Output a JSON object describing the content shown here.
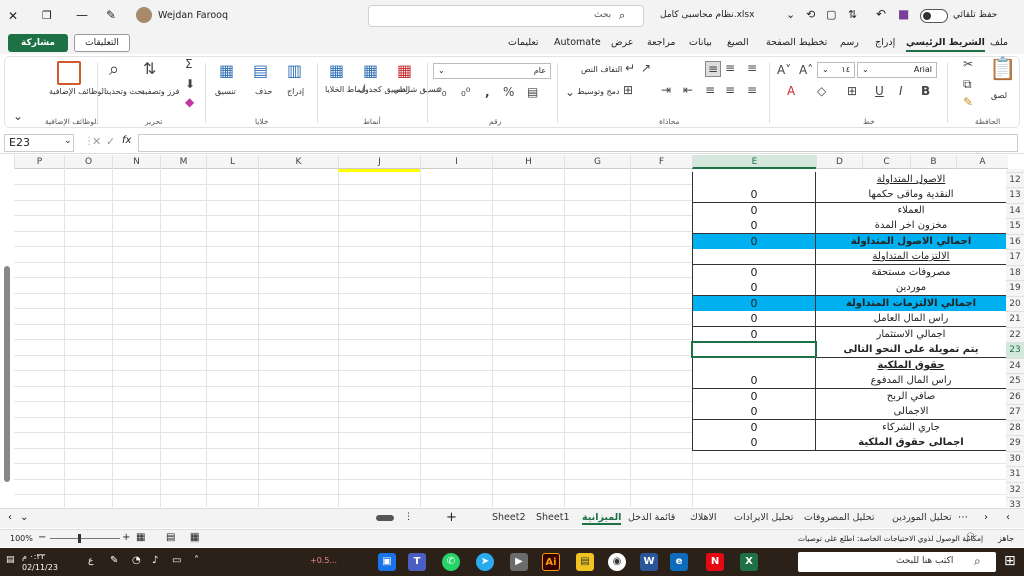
{
  "titlebar": {
    "autosave_label": "حفظ تلقائي",
    "file_name": "نظام محاسبى كامل.xlsx",
    "search_placeholder": "بحث",
    "user_name": "Wejdan Farooq"
  },
  "menu": {
    "items": [
      "ملف",
      "الشريط الرئيسي",
      "إدراج",
      "رسم",
      "تخطيط الصفحة",
      "الصيغ",
      "بيانات",
      "مراجعة",
      "عرض",
      "Automate",
      "تعليمات"
    ],
    "active": "الشريط الرئيسي",
    "share_label": "مشاركة",
    "comments_label": "التعليقات"
  },
  "ribbon": {
    "groups": {
      "clipboard": "الحافظة",
      "font": "خط",
      "alignment": "محاذاة",
      "number": "رقم",
      "styles": "أنماط",
      "cells": "خلايا",
      "editing": "تحرير",
      "addins": "الوظائف الإضافية"
    },
    "paste_label": "لصق",
    "font_name": "Arial",
    "font_size": "١٤",
    "wrap_text_label": "التفاف النص",
    "merge_label": "دمج وتوسيط",
    "number_format": "عام",
    "conditional_label": "تنسيق شرطي",
    "format_table_label": "التنسيق كجدول",
    "cell_styles_label": "أنماط الخلايا",
    "insert_label": "إدراج",
    "delete_label": "حذف",
    "format_label": "تنسيق",
    "sort_label": "فرز وتصفية",
    "find_label": "بحث وتحديد",
    "addins_label": "الوظائف الإضافية"
  },
  "formula_bar": {
    "name_box": "E23",
    "fx_label": "fx",
    "content": ""
  },
  "grid": {
    "columns": [
      "A",
      "B",
      "C",
      "D",
      "E",
      "F",
      "G",
      "H",
      "I",
      "J",
      "K",
      "L",
      "M",
      "N",
      "O",
      "P"
    ],
    "selected_column": "E",
    "rows": [
      "12",
      "13",
      "14",
      "15",
      "16",
      "17",
      "18",
      "19",
      "20",
      "21",
      "22",
      "23",
      "24",
      "25",
      "26",
      "27",
      "28",
      "29",
      "30",
      "31",
      "32",
      "33"
    ],
    "selected_row": "23",
    "data_rows": [
      {
        "row": "12",
        "label": "الاصول المتداولة",
        "value": "",
        "style": "underline"
      },
      {
        "row": "13",
        "label": "النقدية وماقى حكمها",
        "value": "0",
        "style": "normal"
      },
      {
        "row": "14",
        "label": "العملاء",
        "value": "0",
        "style": "normal"
      },
      {
        "row": "15",
        "label": "مخزون اخر المدة",
        "value": "0",
        "style": "normal"
      },
      {
        "row": "16",
        "label": "اجمالي الاصول المتداولة",
        "value": "0",
        "style": "highlight"
      },
      {
        "row": "17",
        "label": "الالتزمات المتداولة",
        "value": "",
        "style": "underline"
      },
      {
        "row": "18",
        "label": "مصروفات مستحقة",
        "value": "0",
        "style": "normal"
      },
      {
        "row": "19",
        "label": "موردين",
        "value": "0",
        "style": "normal"
      },
      {
        "row": "20",
        "label": "اجمالي الالتزمات المتداولة",
        "value": "0",
        "style": "highlight"
      },
      {
        "row": "21",
        "label": "راس المال العامل",
        "value": "0",
        "style": "normal"
      },
      {
        "row": "22",
        "label": "اجمالي الاستثمار",
        "value": "0",
        "style": "normal"
      },
      {
        "row": "23",
        "label": "يتم تمويلة على النحو التالى",
        "value": "",
        "style": "bold"
      },
      {
        "row": "24",
        "label": "حقوق الملكية",
        "value": "",
        "style": "bold-underline"
      },
      {
        "row": "25",
        "label": "راس المال المدفوع",
        "value": "0",
        "style": "normal"
      },
      {
        "row": "26",
        "label": "صافي الربح",
        "value": "0",
        "style": "normal"
      },
      {
        "row": "27",
        "label": "الاجمالى",
        "value": "0",
        "style": "normal"
      },
      {
        "row": "28",
        "label": "جاري الشركاء",
        "value": "0",
        "style": "normal"
      },
      {
        "row": "29",
        "label": "اجمالى حقوق الملكية",
        "value": "0",
        "style": "bold"
      }
    ]
  },
  "sheet_tabs": [
    "تحليل الموردين",
    "تحليل المصروفات",
    "تحليل الايرادات",
    "الاهلاك",
    "قائمة الدخل",
    "الميزانية",
    "Sheet1",
    "Sheet2"
  ],
  "active_sheet": "الميزانية",
  "statusbar": {
    "ready": "جاهز",
    "accessibility": "إمكانية الوصول لذوي الاحتياجات الخاصة: اطلع على توصيات",
    "zoom": "100%"
  },
  "taskbar": {
    "search_placeholder": "اكتب هنا للبحث",
    "time": "٠:٣٣ م",
    "date": "02/11/23",
    "temp": "+0.5..."
  },
  "colors": {
    "accent": "#1e7145",
    "highlight": "#00b0f0",
    "taskbar": "#2b2118"
  }
}
